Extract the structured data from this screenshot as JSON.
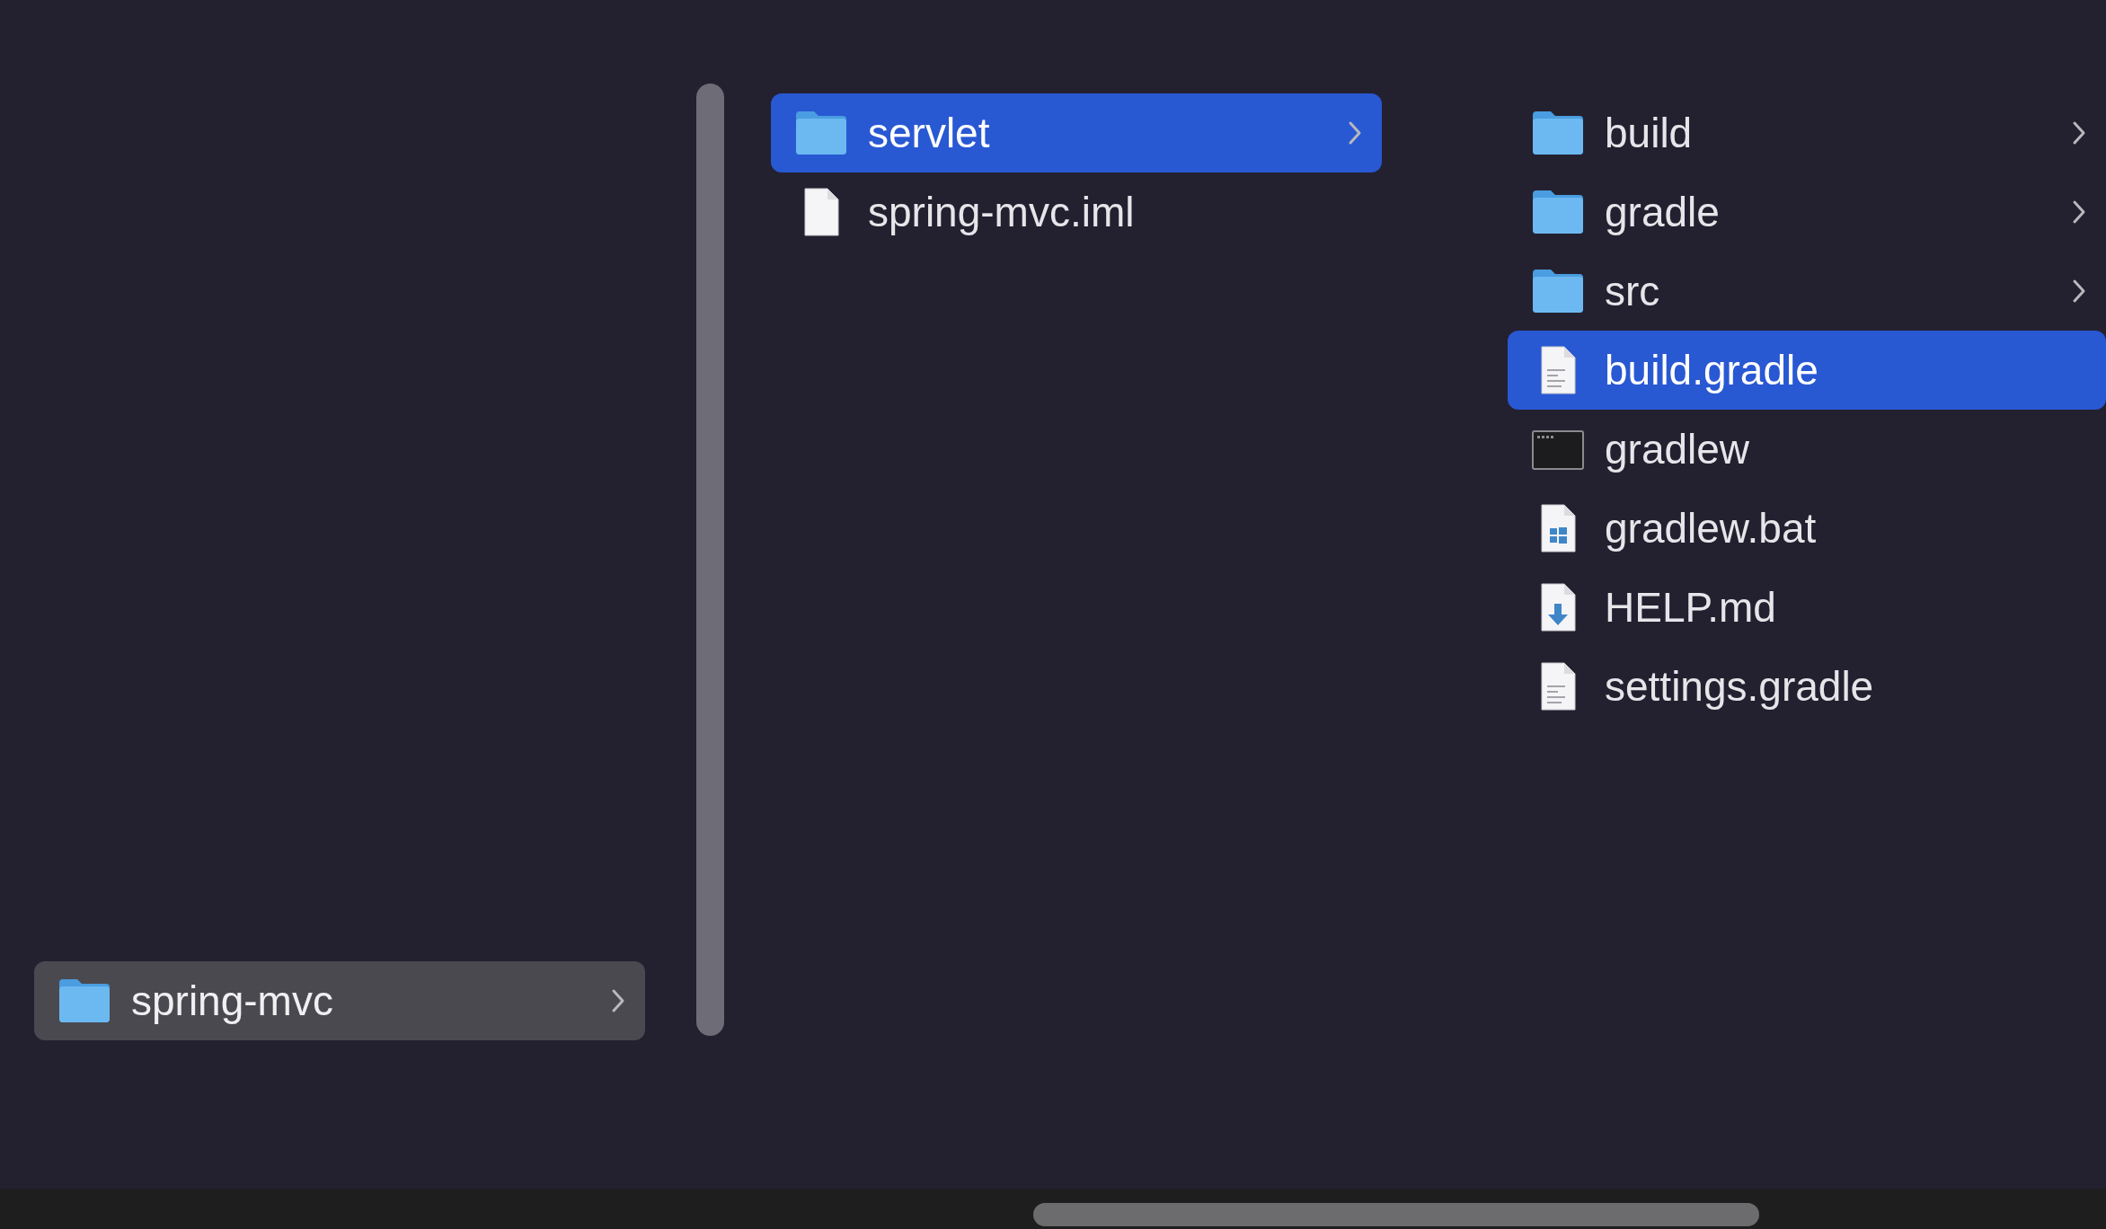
{
  "columns": [
    {
      "active": false,
      "items": [
        {
          "name": "spring-mvc",
          "kind": "folder",
          "selected": true
        }
      ]
    },
    {
      "active": true,
      "items": [
        {
          "name": "servlet",
          "kind": "folder",
          "selected": true
        },
        {
          "name": "spring-mvc.iml",
          "kind": "blank",
          "selected": false
        }
      ]
    },
    {
      "active": true,
      "items": [
        {
          "name": "build",
          "kind": "folder",
          "selected": false
        },
        {
          "name": "gradle",
          "kind": "folder",
          "selected": false
        },
        {
          "name": "src",
          "kind": "folder",
          "selected": false
        },
        {
          "name": "build.gradle",
          "kind": "text",
          "selected": true
        },
        {
          "name": "gradlew",
          "kind": "exec",
          "selected": false
        },
        {
          "name": "gradlew.bat",
          "kind": "windows",
          "selected": false
        },
        {
          "name": "HELP.md",
          "kind": "download",
          "selected": false
        },
        {
          "name": "settings.gradle",
          "kind": "text",
          "selected": false
        }
      ]
    }
  ]
}
